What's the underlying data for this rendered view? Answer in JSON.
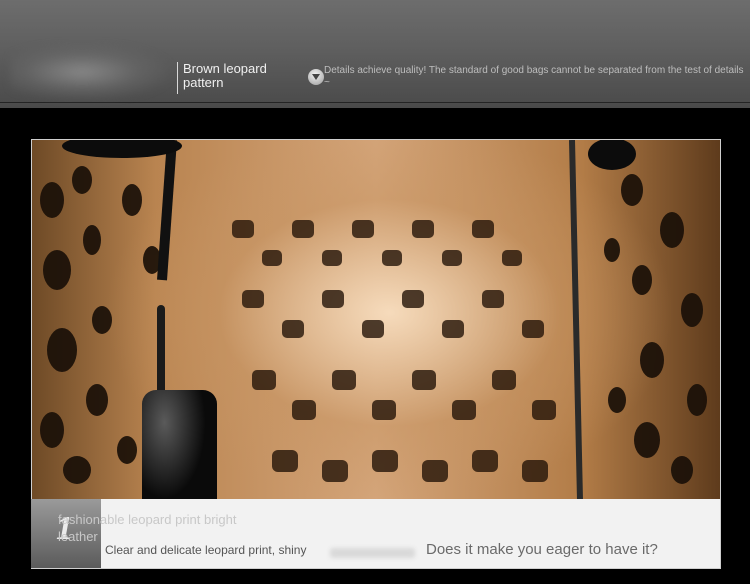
{
  "header": {
    "title": "Brown leopard pattern",
    "description": "Details achieve quality! The standard of good bags cannot be separated from the test of details ~"
  },
  "feature": {
    "number": "1",
    "title": "fashionable leopard print bright leather",
    "description": "Clear and delicate leopard print, shiny",
    "cta": "Does it make you eager to have it?"
  },
  "colors": {
    "header_bg": "#5f5f5f",
    "page_bg": "#000000",
    "panel_bg": "#f2f2f2"
  },
  "icons": [
    "chevron-down-icon"
  ]
}
